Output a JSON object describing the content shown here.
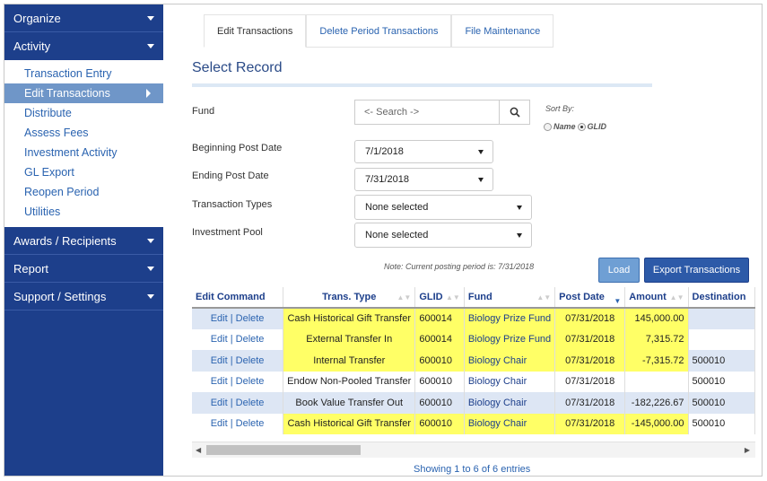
{
  "sidebar": {
    "sections": [
      "Organize",
      "Activity",
      "Awards / Recipients",
      "Report",
      "Support / Settings"
    ],
    "activity_items": [
      "Transaction Entry",
      "Edit Transactions",
      "Distribute",
      "Assess Fees",
      "Investment Activity",
      "GL Export",
      "Reopen Period",
      "Utilities"
    ]
  },
  "tabs": [
    "Edit Transactions",
    "Delete Period Transactions",
    "File Maintenance"
  ],
  "page_title": "Select Record",
  "form": {
    "fund_label": "Fund",
    "search_placeholder": "<- Search ->",
    "sort_by_label": "Sort By:",
    "sort_name": "Name",
    "sort_glid": "GLID",
    "begin_label": "Beginning Post Date",
    "begin_value": "7/1/2018",
    "end_label": "Ending Post Date",
    "end_value": "7/31/2018",
    "types_label": "Transaction Types",
    "types_value": "None selected",
    "pool_label": "Investment Pool",
    "pool_value": "None selected"
  },
  "note": "Note: Current posting period is: 7/31/2018",
  "buttons": {
    "load": "Load",
    "export": "Export Transactions"
  },
  "table": {
    "headers": [
      "Edit Command",
      "Trans. Type",
      "GLID",
      "Fund",
      "Post Date",
      "Amount",
      "Destination"
    ],
    "rows": [
      {
        "cmd": "Edit | Delete",
        "type": "Cash Historical Gift Transfer",
        "glid": "600014",
        "fund": "Biology Prize Fund",
        "date": "07/31/2018",
        "amount": "145,000.00",
        "dest": ""
      },
      {
        "cmd": "Edit | Delete",
        "type": "External Transfer In",
        "glid": "600014",
        "fund": "Biology Prize Fund",
        "date": "07/31/2018",
        "amount": "7,315.72",
        "dest": ""
      },
      {
        "cmd": "Edit | Delete",
        "type": "Internal Transfer",
        "glid": "600010",
        "fund": "Biology Chair",
        "date": "07/31/2018",
        "amount": "-7,315.72",
        "dest": "500010"
      },
      {
        "cmd": "Edit | Delete",
        "type": "Endow Non-Pooled Transfer",
        "glid": "600010",
        "fund": "Biology Chair",
        "date": "07/31/2018",
        "amount": "",
        "dest": "500010"
      },
      {
        "cmd": "Edit | Delete",
        "type": "Book Value Transfer Out",
        "glid": "600010",
        "fund": "Biology Chair",
        "date": "07/31/2018",
        "amount": "-182,226.67",
        "dest": "500010"
      },
      {
        "cmd": "Edit | Delete",
        "type": "Cash Historical Gift Transfer",
        "glid": "600010",
        "fund": "Biology Chair",
        "date": "07/31/2018",
        "amount": "-145,000.00",
        "dest": "500010"
      }
    ]
  },
  "table_info": "Showing 1 to 6 of 6 entries",
  "colors": {
    "sidebar": "#1d3f8b",
    "highlight": "#ffff66",
    "row_alt": "#dde6f4"
  }
}
